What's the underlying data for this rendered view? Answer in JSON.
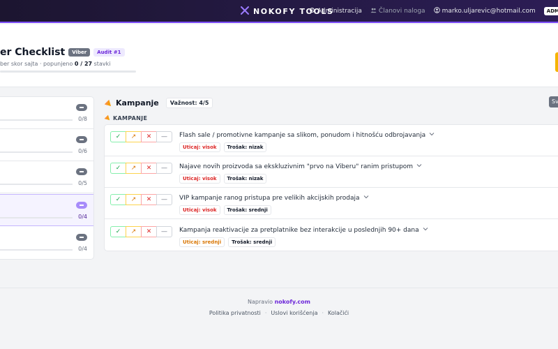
{
  "topbar": {
    "brand": "NOKOFY TOOLS",
    "nav": {
      "admin": "Administracija",
      "members": "Članovi naloga",
      "email": "marko.uljarevic@hotmail.com",
      "adm_badge": "ADM"
    }
  },
  "header": {
    "title": "er Checklist",
    "badge_platform": "Viber",
    "badge_audit": "Audit #1",
    "subtitle_prefix": "ber skor sajta · popunjeno",
    "subtitle_count": "0 / 27",
    "subtitle_suffix": "stavki",
    "progress": 0
  },
  "sidebar": {
    "items": [
      {
        "count": "0/8",
        "active": false
      },
      {
        "count": "0/6",
        "active": false
      },
      {
        "count": "0/5",
        "active": false
      },
      {
        "count": "0/4",
        "active": true
      },
      {
        "count": "0/4",
        "active": false
      }
    ]
  },
  "category": {
    "title": "Kampanje",
    "importance": "Važnost: 4/5",
    "section_label": "KAMPANJE",
    "side_button": "Sve"
  },
  "status_buttons": {
    "ok": "✓",
    "partial": "↗",
    "fail": "✕",
    "na": "—"
  },
  "items": [
    {
      "text": "Flash sale / promotivne kampanje sa slikom, ponudom i hitnošću odbrojavanja",
      "impact": "Uticaj: visok",
      "impact_level": "high",
      "cost": "Trošak: nizak"
    },
    {
      "text": "Najave novih proizvoda sa ekskluzivnim \"prvo na Viberu\" ranim pristupom",
      "impact": "Uticaj: visok",
      "impact_level": "high",
      "cost": "Trošak: nizak"
    },
    {
      "text": "VIP kampanje ranog pristupa pre velikih akcijskih prodaja",
      "impact": "Uticaj: visok",
      "impact_level": "high",
      "cost": "Trošak: srednji"
    },
    {
      "text": "Kampanja reaktivacije za pretplatnike bez interakcije u poslednjih 90+ dana",
      "impact": "Uticaj: srednji",
      "impact_level": "mid",
      "cost": "Trošak: srednji"
    }
  ],
  "footer": {
    "made_by": "Napravio",
    "made_by_link": "nokofy.com",
    "links": [
      "Politika privatnosti",
      "Uslovi korišćenja",
      "Kolačići"
    ],
    "separator": "·"
  },
  "colors": {
    "accent": "#7c4dff",
    "topbar": "#251a45",
    "ok": "#16a34a",
    "partial": "#d97706",
    "fail": "#dc2626"
  }
}
